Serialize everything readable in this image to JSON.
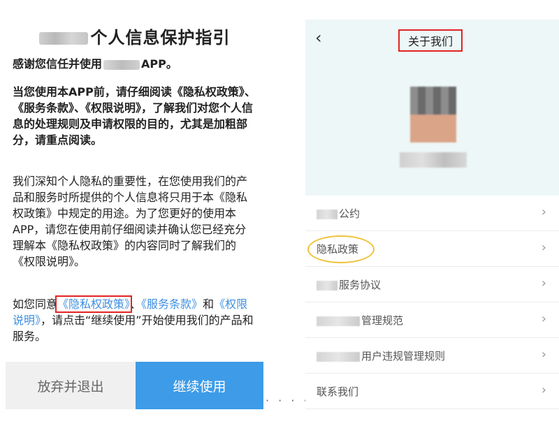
{
  "dialog": {
    "title": "个人信息保护指引",
    "p1_a": "感谢您信任并使用",
    "p1_b": "APP。",
    "p2": "当您使用本APP前，请仔细阅读《隐私权政策》、《服务条款》、《权限说明》，了解我们对您个人信息的处理规则及申请权限的目的，尤其是加粗部分，请重点阅读。",
    "p3": "我们深知个人隐私的重要性，在您使用我们的产品和服务时所提供的个人信息将只用于本《隐私权政策》中规定的用途。为了您更好的使用本APP，请您在使用前仔细阅读并确认您已经充分理解本《隐私权政策》的内容同时了解我们的《权限说明》。",
    "p4_a": "如您同意",
    "link_privacy": "《隐私权政策》",
    "p4_sep": "、",
    "link_terms": "《服务条款》",
    "p4_and": "和",
    "link_permissions": "《权限说明》",
    "p4_b": "，请点击“继续使用”开始使用我们的产品和服务。",
    "btn_quit": "放弃并退出",
    "btn_continue": "继续使用",
    "dots": "· · · ·"
  },
  "about": {
    "back": "‹",
    "title": "关于我们",
    "items": [
      {
        "label": "公约",
        "chevron": "›"
      },
      {
        "label": "隐私政策",
        "chevron": "›"
      },
      {
        "label": "服务协议",
        "chevron": "›"
      },
      {
        "label": "管理规范",
        "chevron": "›"
      },
      {
        "label": "用户违规管理规则",
        "chevron": "›"
      },
      {
        "label": "联系我们",
        "chevron": "›"
      }
    ]
  },
  "colors": {
    "link": "#3d8fe0",
    "continue_button": "#3e9be8",
    "highlight_red": "#e02424",
    "highlight_yellow": "#f0c23a",
    "header_bg": "#eef7f7"
  },
  "icons": {
    "back": "chevron-left-icon",
    "menu_arrow": "chevron-right-icon"
  }
}
